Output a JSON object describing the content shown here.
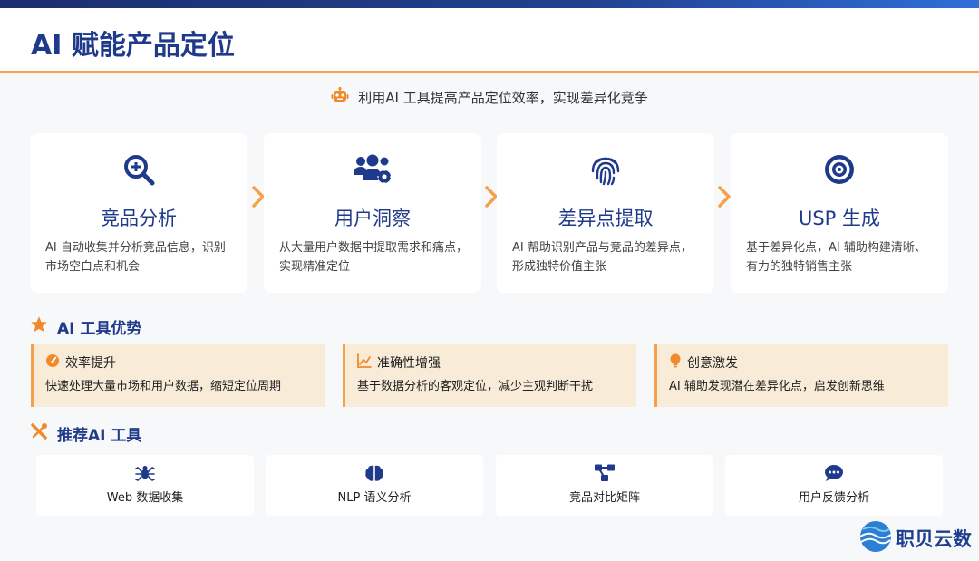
{
  "header": {
    "title": "AI 赋能产品定位"
  },
  "subtitle": {
    "text": "利用AI 工具提高产品定位效率，实现差异化竞争",
    "icon": "robot-icon"
  },
  "steps": [
    {
      "icon": "search-plus-icon",
      "title": "竞品分析",
      "desc": "AI 自动收集并分析竞品信息，识别市场空白点和机会"
    },
    {
      "icon": "users-gear-icon",
      "title": "用户洞察",
      "desc": "从大量用户数据中提取需求和痛点，实现精准定位"
    },
    {
      "icon": "fingerprint-icon",
      "title": "差异点提取",
      "desc": "AI 帮助识别产品与竞品的差异点，形成独特价值主张"
    },
    {
      "icon": "target-icon",
      "title": "USP 生成",
      "desc": "基于差异化点，AI 辅助构建清晰、有力的独特销售主张"
    }
  ],
  "advantages_section": {
    "title": "AI 工具优势",
    "icon": "star-icon"
  },
  "advantages": [
    {
      "icon": "gauge-icon",
      "title": "效率提升",
      "desc": "快速处理大量市场和用户数据，缩短定位周期"
    },
    {
      "icon": "chart-line-icon",
      "title": "准确性增强",
      "desc": "基于数据分析的客观定位，减少主观判断干扰"
    },
    {
      "icon": "lightbulb-icon",
      "title": "创意激发",
      "desc": "AI 辅助发现潜在差异化点，启发创新思维"
    }
  ],
  "tools_section": {
    "title": "推荐AI 工具",
    "icon": "tools-icon"
  },
  "tools": [
    {
      "icon": "spider-icon",
      "label": "Web  数据收集"
    },
    {
      "icon": "brain-icon",
      "label": "NLP 语义分析"
    },
    {
      "icon": "network-icon",
      "label": "竞品对比矩阵"
    },
    {
      "icon": "comment-dots-icon",
      "label": "用户反馈分析"
    }
  ],
  "logo": {
    "text": "职贝云数"
  },
  "colors": {
    "primary": "#1f3a8a",
    "accent": "#f5a04a",
    "card_bg": "#ffffff",
    "adv_bg": "#f8ecd9"
  }
}
